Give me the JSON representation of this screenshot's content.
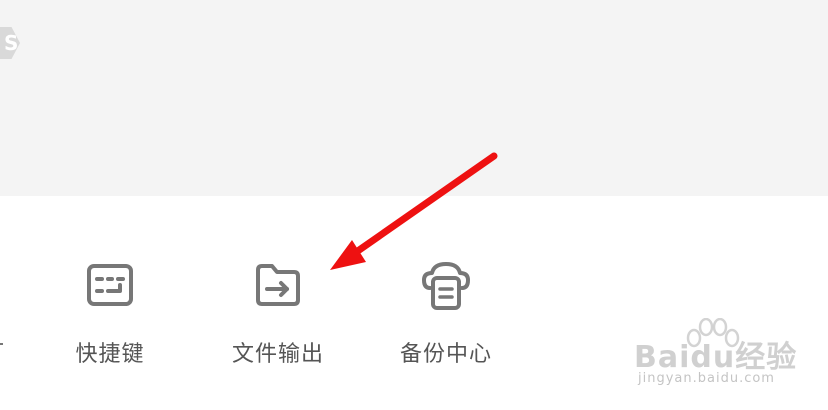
{
  "colors": {
    "top_panel_bg": "#f4f4f4",
    "icon_stroke": "#777777",
    "label_text": "#555555",
    "annotation_arrow": "#ee1111"
  },
  "tools": [
    {
      "label": "快捷键",
      "icon": "keyboard-shortcut-icon"
    },
    {
      "label": "文件输出",
      "icon": "folder-export-icon"
    },
    {
      "label": "备份中心",
      "icon": "cloud-backup-icon"
    }
  ],
  "watermark": {
    "brand": "Baidu经验",
    "url": "jingyan.baidu.com"
  },
  "annotation": {
    "type": "red-arrow",
    "points_to": "文件输出"
  }
}
